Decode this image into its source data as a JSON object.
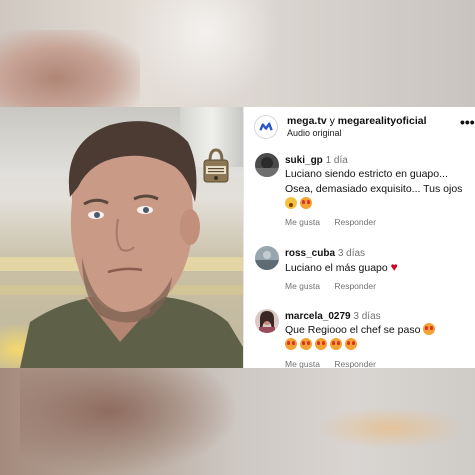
{
  "post": {
    "account_primary": "mega.tv",
    "account_connector": "y",
    "account_secondary": "megarealityoficial",
    "audio": "Audio original",
    "more_icon": "more-horizontal-icon",
    "badge_text": "FÁBRICA DE CHEFS"
  },
  "comments": [
    {
      "username": "suki_gp",
      "time": "1 día",
      "text": "Luciano siendo estricto en guapo... Osea, demasiado exquisito... Tus ojos",
      "emojis": [
        "hushed-face-emoji",
        "heart-eyes-emoji"
      ],
      "like_label": "Me gusta",
      "reply_label": "Responder"
    },
    {
      "username": "ross_cuba",
      "time": "3 días",
      "text": "Luciano el más guapo",
      "emojis": [
        "red-heart-emoji"
      ],
      "like_label": "Me gusta",
      "reply_label": "Responder"
    },
    {
      "username": "marcela_0279",
      "time": "3 días",
      "text": "Que Regiooo el chef se paso",
      "emojis": [
        "heart-eyes-emoji",
        "heart-eyes-emoji",
        "heart-eyes-emoji",
        "heart-eyes-emoji",
        "heart-eyes-emoji",
        "heart-eyes-emoji"
      ],
      "like_label": "Me gusta",
      "reply_label": "Responder"
    }
  ],
  "colors": {
    "username": "#111111",
    "meta": "#737373",
    "heart": "#d0021b",
    "emoji_face": "#f3a233"
  }
}
